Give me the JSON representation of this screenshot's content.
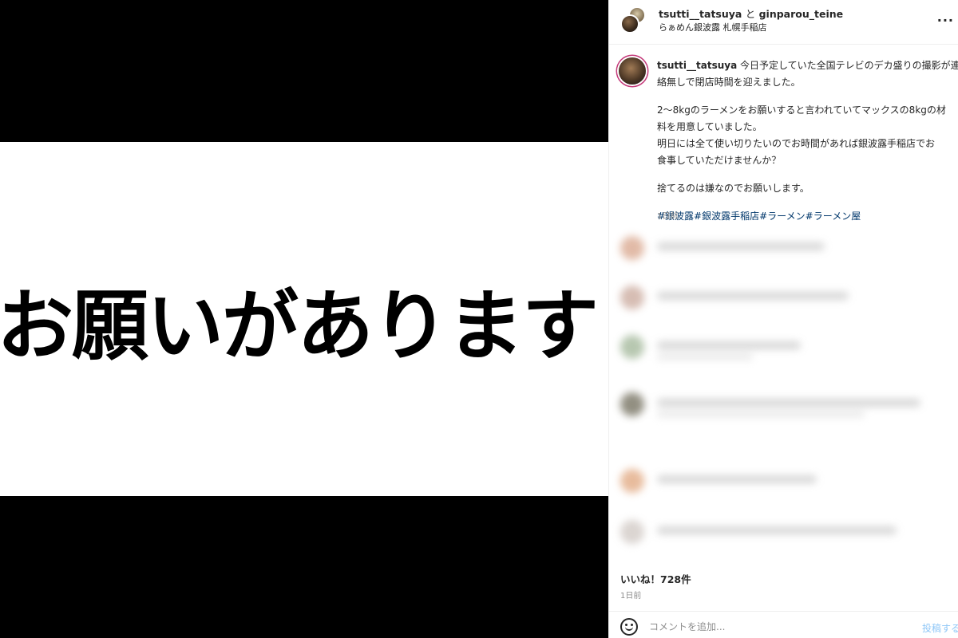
{
  "media": {
    "text": "お願いがあります"
  },
  "post_header": {
    "user1": "tsutti__tatsuya",
    "conj": "と",
    "user2": "ginparou_teine",
    "location": "らぁめん銀波露 札幌手稲店",
    "more": "..."
  },
  "caption": {
    "username": "tsutti__tatsuya",
    "line1": "今日予定していた全国テレビのデカ盛りの撮影が連",
    "line2": "絡無しで閉店時間を迎えました。",
    "line3": "2〜8kgのラーメンをお願いすると言われていてマックスの8kgの材",
    "line4": "料を用意していました。",
    "line5": "明日には全て使い切りたいのでお時間があれば銀波露手稲店でお",
    "line6": "食事していただけませんか？",
    "line7": "捨てるのは嫌なのでお願いします。",
    "hashtags": "#銀波露#銀波露手稲店#ラーメン#ラーメン屋",
    "time": "1日前"
  },
  "likes": "いいね！728件",
  "post_time": "1日前",
  "comment_box": {
    "placeholder": "コメントを追加...",
    "post_label": "投稿する"
  },
  "colors": {
    "link": "#00376b",
    "post_button": "#8fc7f7",
    "muted": "#8e8e8e"
  }
}
